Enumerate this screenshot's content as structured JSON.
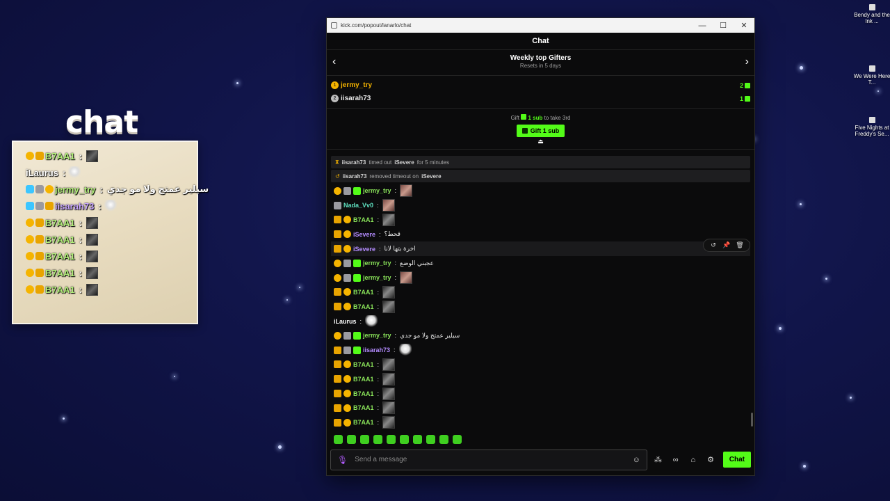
{
  "desktop": {
    "icons": [
      {
        "label": "Bendy and the Ink ..."
      },
      {
        "label": "We Were Here T..."
      },
      {
        "label": "Five Nights at Freddy's Se..."
      }
    ]
  },
  "overlay": {
    "title": "chat",
    "lines": [
      {
        "name": "B7AA1",
        "sep": ":",
        "text": ""
      },
      {
        "name": "iLaurus",
        "sep": ":",
        "text": ""
      },
      {
        "name": "jermy_try",
        "sep": ":",
        "text": "سيلير عمتج ولا مو جدي"
      },
      {
        "name": "iisarah73",
        "sep": ":",
        "text": ""
      },
      {
        "name": "B7AA1",
        "sep": ":",
        "text": ""
      },
      {
        "name": "B7AA1",
        "sep": ":",
        "text": ""
      },
      {
        "name": "B7AA1",
        "sep": ":",
        "text": ""
      },
      {
        "name": "B7AA1",
        "sep": ":",
        "text": ""
      },
      {
        "name": "B7AA1",
        "sep": ":",
        "text": ""
      }
    ]
  },
  "window": {
    "url": "kick.com/popout/lanarlo/chat",
    "controls": {
      "minimize": "—",
      "maximize": "☐",
      "close": "✕"
    }
  },
  "chat": {
    "title": "Chat",
    "gifters": {
      "title": "Weekly top Gifters",
      "subtitle": "Resets in 5 days",
      "rows": [
        {
          "rank": "1",
          "name": "jermy_try",
          "count": "2"
        },
        {
          "rank": "2",
          "name": "iisarah73",
          "count": "1"
        }
      ],
      "cta_prefix": "Gift",
      "cta_amount": "1 sub",
      "cta_suffix": "to take 3rd",
      "button": "Gift 1 sub"
    },
    "system": [
      {
        "actor": "iisarah73",
        "action": "timed out",
        "target": "iSevere",
        "tail": "for 5 minutes"
      },
      {
        "actor": "iisarah73",
        "action": "removed timeout on",
        "target": "iSevere",
        "tail": ""
      }
    ],
    "messages": [
      {
        "name": "jermy_try",
        "text": ""
      },
      {
        "name": "Nada_Vv0",
        "text": ""
      },
      {
        "name": "B7AA1",
        "text": ""
      },
      {
        "name": "iSevere",
        "text": "قحط؟"
      },
      {
        "name": "iSevere",
        "text": "اخرة بتها لانا"
      },
      {
        "name": "jermy_try",
        "text": "عجبني الوضع"
      },
      {
        "name": "jermy_try",
        "text": ""
      },
      {
        "name": "B7AA1",
        "text": ""
      },
      {
        "name": "B7AA1",
        "text": ""
      },
      {
        "name": "iLaurus",
        "text": ""
      },
      {
        "name": "jermy_try",
        "text": "سيلير عمتج ولا مو جدي"
      },
      {
        "name": "iisarah73",
        "text": ""
      },
      {
        "name": "B7AA1",
        "text": ""
      },
      {
        "name": "B7AA1",
        "text": ""
      },
      {
        "name": "B7AA1",
        "text": ""
      },
      {
        "name": "B7AA1",
        "text": ""
      },
      {
        "name": "B7AA1",
        "text": ""
      }
    ],
    "input_placeholder": "Send a message",
    "send_label": "Chat"
  },
  "colors": {
    "accent": "#53fc18",
    "bg": "#0b0b0c"
  }
}
